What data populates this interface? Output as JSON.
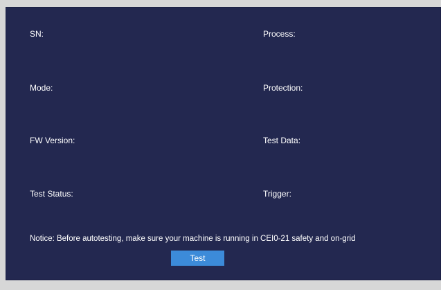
{
  "fields": {
    "sn": "SN:",
    "process": "Process:",
    "mode": "Mode:",
    "protection": "Protection:",
    "fw_version": "FW Version:",
    "test_data": "Test Data:",
    "test_status": "Test Status:",
    "trigger": "Trigger:"
  },
  "notice": "Notice: Before autotesting, make sure your machine is running in CEI0-21 safety and on-grid",
  "test_button": "Test",
  "colors": {
    "panel_background": "#232850",
    "button_background": "#3c8bd9",
    "outer_background": "#d7d7d7",
    "text": "#ffffff"
  }
}
